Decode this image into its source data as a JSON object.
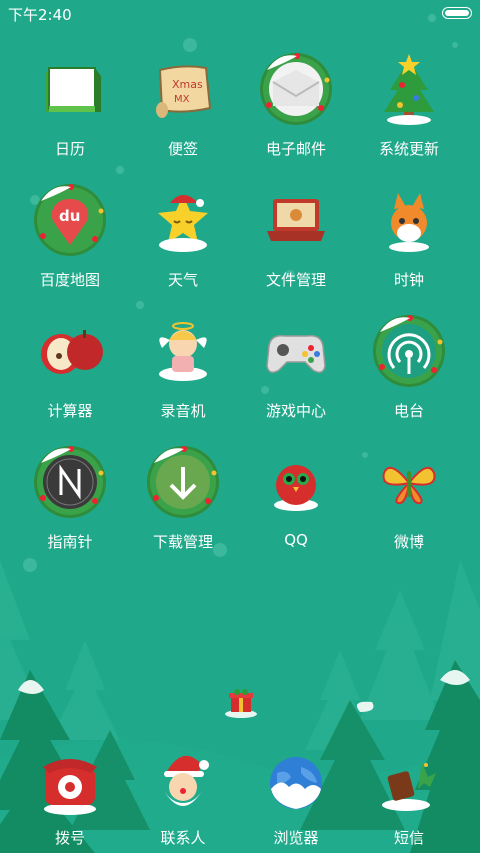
{
  "status_bar": {
    "time": "下午2:40",
    "battery_icon": "battery-icon"
  },
  "apps": [
    {
      "label": "日历",
      "icon": "calendar-icon"
    },
    {
      "label": "便签",
      "icon": "notes-icon"
    },
    {
      "label": "电子邮件",
      "icon": "email-icon"
    },
    {
      "label": "系统更新",
      "icon": "system-update-icon"
    },
    {
      "label": "百度地图",
      "icon": "baidu-map-icon"
    },
    {
      "label": "天气",
      "icon": "weather-icon"
    },
    {
      "label": "文件管理",
      "icon": "file-manager-icon"
    },
    {
      "label": "时钟",
      "icon": "clock-icon"
    },
    {
      "label": "计算器",
      "icon": "calculator-icon"
    },
    {
      "label": "录音机",
      "icon": "recorder-icon"
    },
    {
      "label": "游戏中心",
      "icon": "game-center-icon"
    },
    {
      "label": "电台",
      "icon": "radio-icon"
    },
    {
      "label": "指南针",
      "icon": "compass-icon"
    },
    {
      "label": "下载管理",
      "icon": "download-manager-icon"
    },
    {
      "label": "QQ",
      "icon": "qq-icon"
    },
    {
      "label": "微博",
      "icon": "weibo-icon"
    }
  ],
  "dock": [
    {
      "label": "拨号",
      "icon": "phone-icon"
    },
    {
      "label": "联系人",
      "icon": "contacts-icon"
    },
    {
      "label": "浏览器",
      "icon": "browser-icon"
    },
    {
      "label": "短信",
      "icon": "messages-icon"
    }
  ],
  "colors": {
    "background": "#1fa88a",
    "tree": "#17996f",
    "snow": "#e8f6f2"
  }
}
